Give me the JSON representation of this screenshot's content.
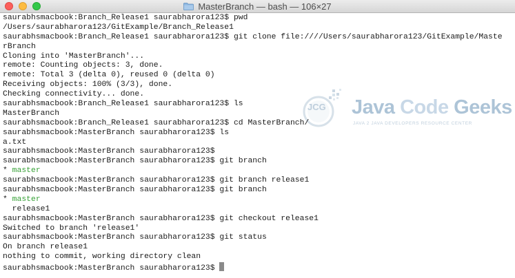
{
  "window": {
    "title": "MasterBranch — bash — 106×27",
    "title_icon": "folder-icon",
    "controls": [
      "close-button",
      "minimize-button",
      "zoom-button"
    ]
  },
  "terminal": {
    "lines": [
      {
        "text": "saurabhsmacbook:Branch_Release1 saurabharora123$ pwd"
      },
      {
        "text": "/Users/saurabharora123/GitExample/Branch_Release1"
      },
      {
        "text": "saurabhsmacbook:Branch_Release1 saurabharora123$ git clone file:////Users/saurabharora123/GitExample/Maste"
      },
      {
        "text": "rBranch"
      },
      {
        "text": "Cloning into 'MasterBranch'..."
      },
      {
        "text": "remote: Counting objects: 3, done."
      },
      {
        "text": "remote: Total 3 (delta 0), reused 0 (delta 0)"
      },
      {
        "text": "Receiving objects: 100% (3/3), done."
      },
      {
        "text": "Checking connectivity... done."
      },
      {
        "text": "saurabhsmacbook:Branch_Release1 saurabharora123$ ls"
      },
      {
        "text": "MasterBranch"
      },
      {
        "text": "saurabhsmacbook:Branch_Release1 saurabharora123$ cd MasterBranch/"
      },
      {
        "text": "saurabhsmacbook:MasterBranch saurabharora123$ ls"
      },
      {
        "text": "a.txt"
      },
      {
        "text": "saurabhsmacbook:MasterBranch saurabharora123$"
      },
      {
        "text": "saurabhsmacbook:MasterBranch saurabharora123$ git branch"
      },
      {
        "prefix": "* ",
        "highlight": "master"
      },
      {
        "text": "saurabhsmacbook:MasterBranch saurabharora123$ git branch release1"
      },
      {
        "text": "saurabhsmacbook:MasterBranch saurabharora123$ git branch"
      },
      {
        "prefix": "* ",
        "highlight": "master"
      },
      {
        "text": "  release1"
      },
      {
        "text": "saurabhsmacbook:MasterBranch saurabharora123$ git checkout release1"
      },
      {
        "text": "Switched to branch 'release1'"
      },
      {
        "text": "saurabhsmacbook:MasterBranch saurabharora123$ git status"
      },
      {
        "text": "On branch release1"
      },
      {
        "text": "nothing to commit, working directory clean"
      },
      {
        "text": "saurabhsmacbook:MasterBranch saurabharora123$ "
      }
    ],
    "current_branch_color": "#37a137"
  },
  "watermark": {
    "logo_text": "JCG",
    "word1": "Java",
    "word2": "Code",
    "word3": "Geeks",
    "tagline": "JAVA 2 JAVA DEVELOPERS RESOURCE CENTER"
  }
}
